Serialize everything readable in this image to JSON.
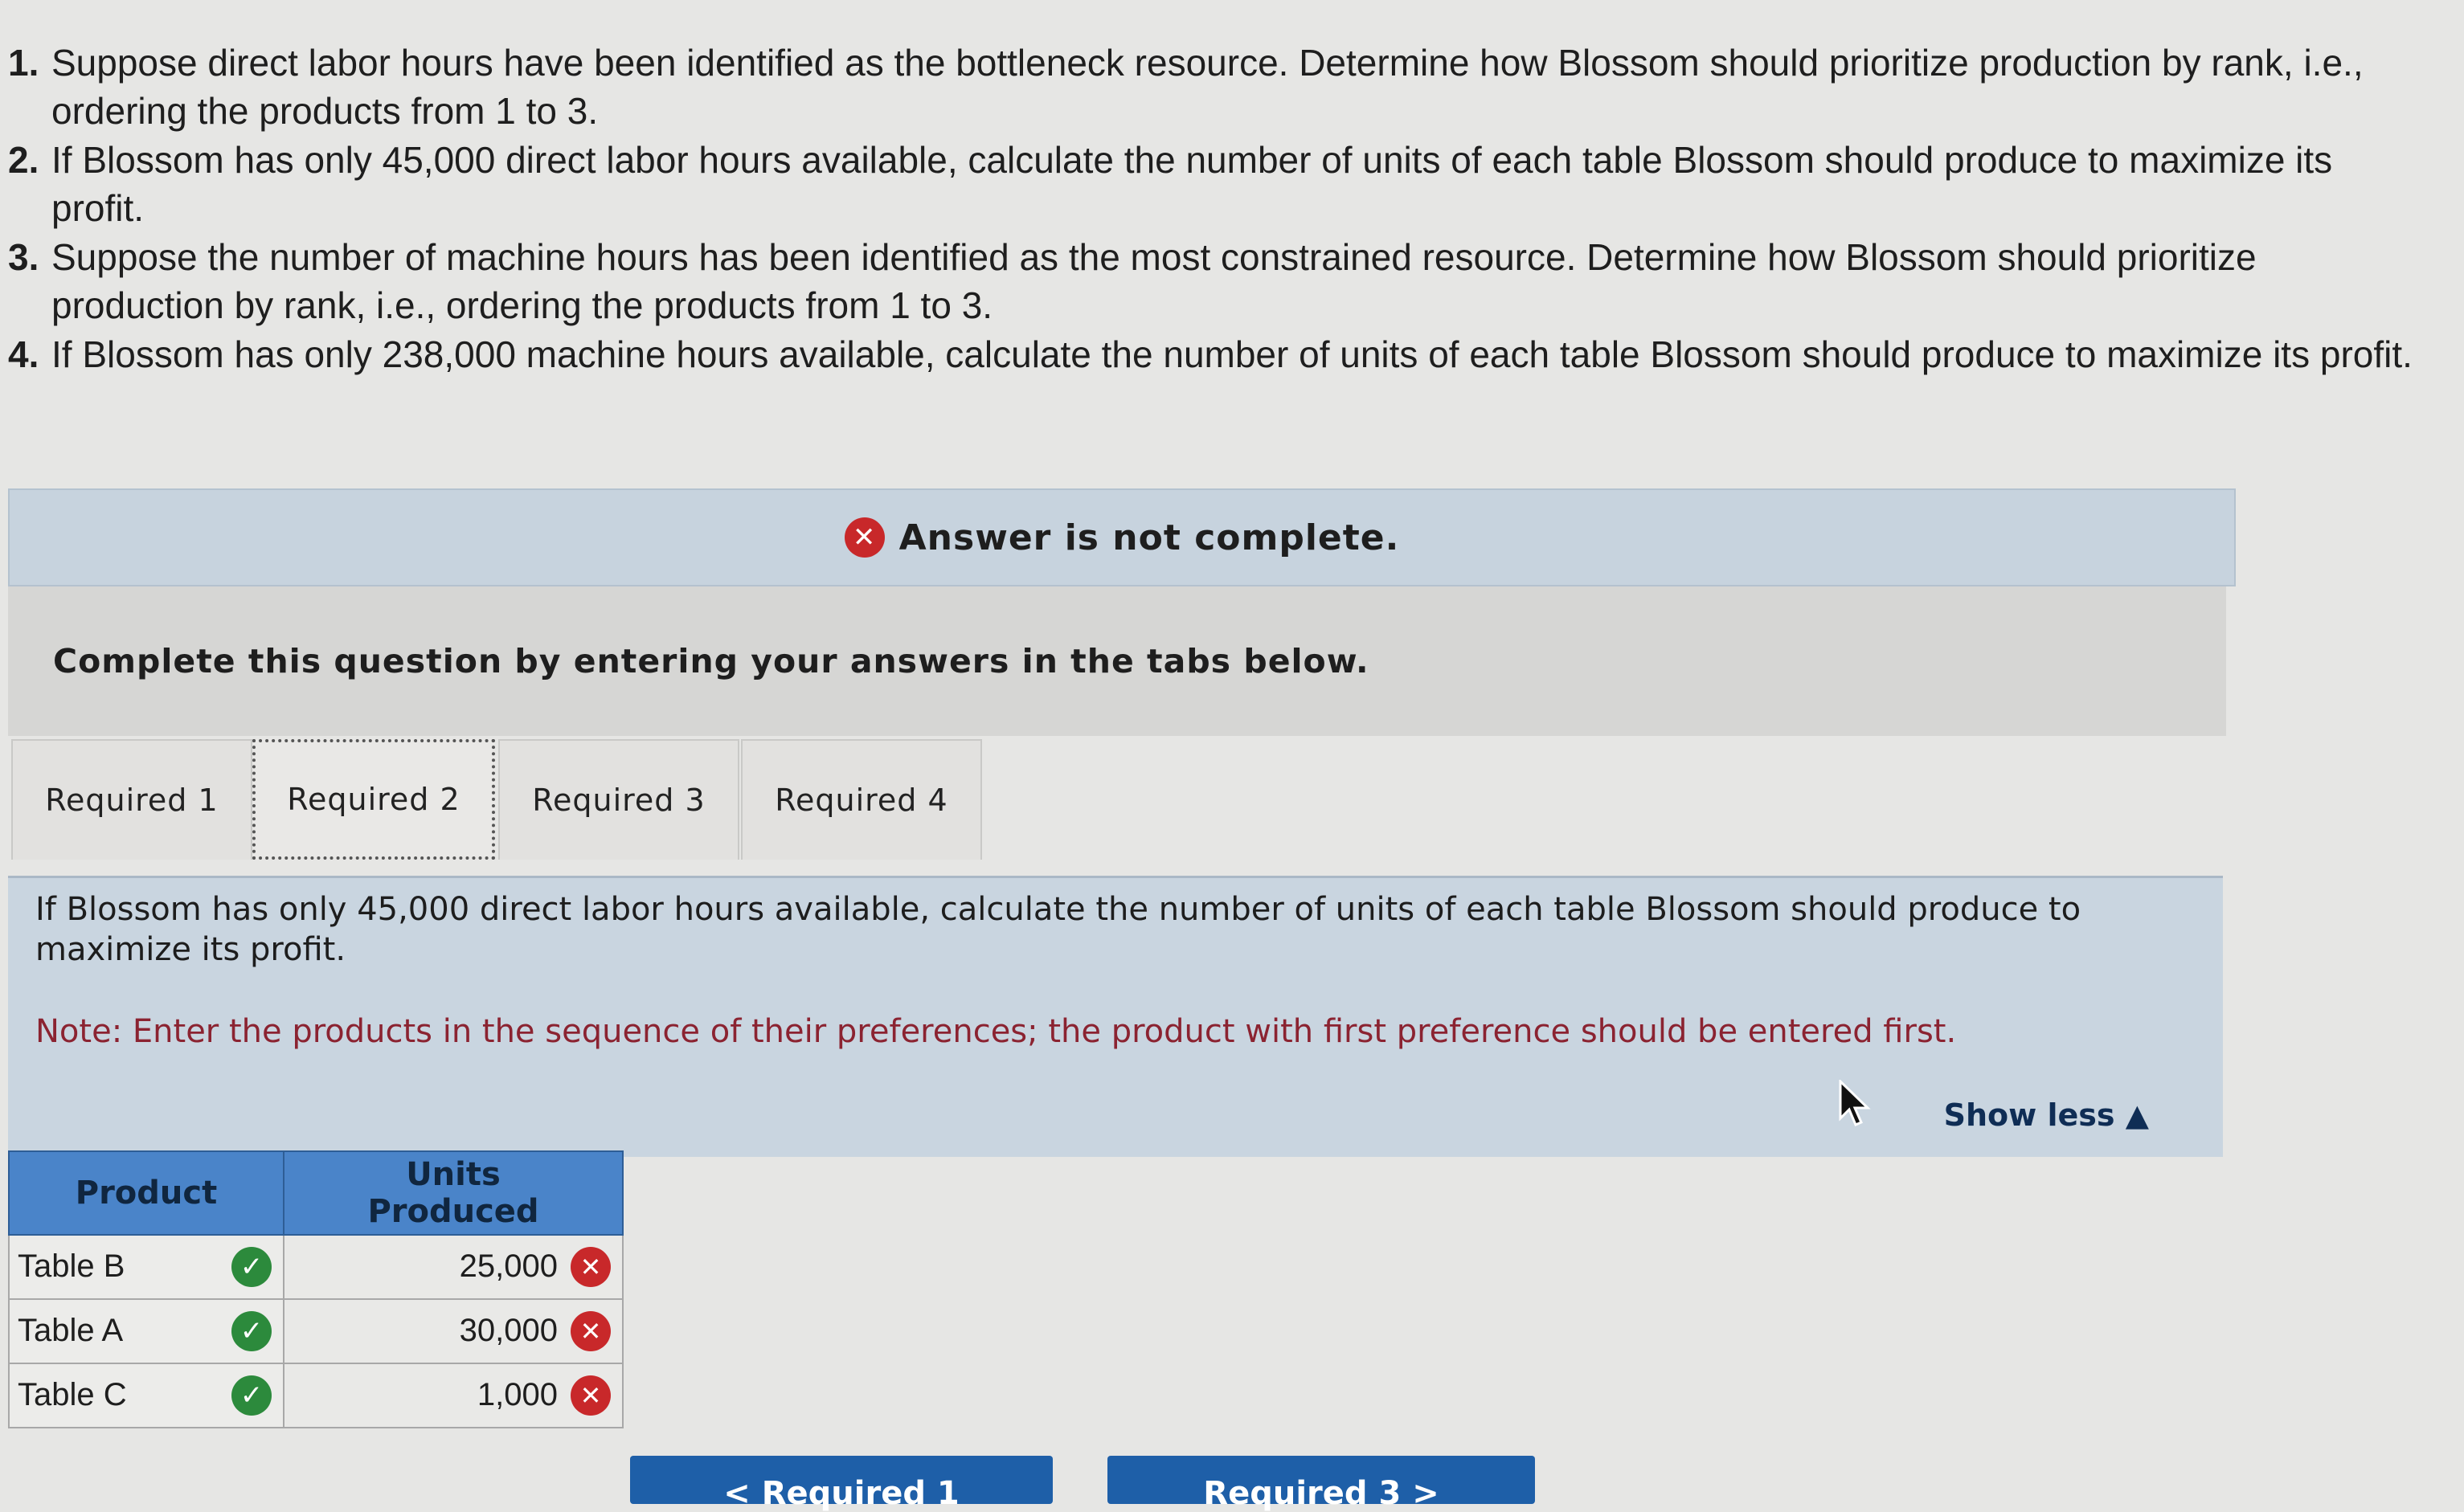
{
  "questions": [
    {
      "num": "1.",
      "text": "Suppose direct labor hours have been identified as the bottleneck resource. Determine how Blossom should prioritize production by rank, i.e., ordering the products from 1 to 3."
    },
    {
      "num": "2.",
      "text": "If Blossom has only 45,000 direct labor hours available, calculate the number of units of each table Blossom should produce to maximize its profit."
    },
    {
      "num": "3.",
      "text": "Suppose the number of machine hours has been identified as the most constrained resource. Determine how Blossom should prioritize production by rank, i.e., ordering the products from 1 to 3."
    },
    {
      "num": "4.",
      "text": "If Blossom has only 238,000 machine hours available, calculate the number of units of each table Blossom should produce to maximize its profit."
    }
  ],
  "banner": {
    "text": "Answer is not complete.",
    "icon": "x-circle-icon",
    "icon_color": "#c8282a"
  },
  "instructions": "Complete this question by entering your answers in the tabs below.",
  "tabs": [
    {
      "label": "Required 1",
      "active": false
    },
    {
      "label": "Required 2",
      "active": true
    },
    {
      "label": "Required 3",
      "active": false
    },
    {
      "label": "Required 4",
      "active": false
    }
  ],
  "content": {
    "description": "If Blossom has only 45,000 direct labor hours available, calculate the number of units of each table Blossom should produce to maximize its profit.",
    "note": "Note: Enter the products in the sequence of their preferences; the product with first preference should be entered first.",
    "show_less": "Show less ▲"
  },
  "table": {
    "headers": [
      "Product",
      "Units Produced"
    ],
    "rows": [
      {
        "product": "Table B",
        "units": "25,000",
        "product_status": "correct",
        "units_status": "incorrect"
      },
      {
        "product": "Table A",
        "units": "30,000",
        "product_status": "correct",
        "units_status": "incorrect"
      },
      {
        "product": "Table C",
        "units": "1,000",
        "product_status": "correct",
        "units_status": "incorrect"
      }
    ]
  },
  "nav": {
    "prev_label": "< Required 1",
    "next_label": "Required 3 >"
  },
  "colors": {
    "correct": "#2c8a3c",
    "incorrect": "#c8282a",
    "header_blue": "#4a84c9",
    "nav_blue": "#1e5fa8"
  }
}
